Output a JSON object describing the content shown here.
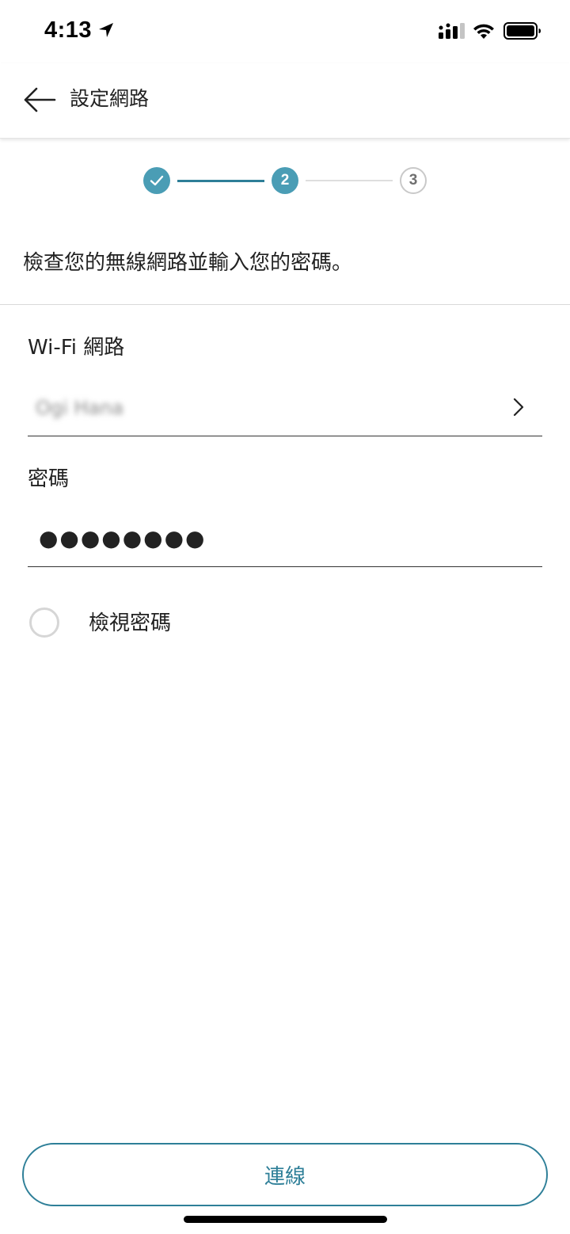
{
  "status_bar": {
    "time": "4:13",
    "icons": [
      "location-arrow-icon",
      "cellular-signal-icon",
      "wifi-icon",
      "battery-icon"
    ]
  },
  "header": {
    "title": "設定網路",
    "back_icon": "arrow-left-icon"
  },
  "stepper": {
    "current_step": 2,
    "total_steps": 3,
    "steps": [
      {
        "label": "",
        "state": "completed",
        "icon": "checkmark-icon"
      },
      {
        "label": "2",
        "state": "current"
      },
      {
        "label": "3",
        "state": "upcoming"
      }
    ],
    "colors": {
      "active": "#4a9db5",
      "line_active": "#2e7f98",
      "inactive": "#c9c9c9"
    }
  },
  "instruction": "檢查您的無線網路並輸入您的密碼。",
  "form": {
    "wifi_label": "Wi-Fi 網路",
    "network_value": "Ogi Hana",
    "network_chevron_icon": "chevron-right-icon",
    "password_label": "密碼",
    "password_value": "●●●●●●●●",
    "show_password_label": "檢視密碼",
    "show_password_checked": false
  },
  "connect_button": {
    "label": "連線",
    "color": "#2e7f98"
  }
}
